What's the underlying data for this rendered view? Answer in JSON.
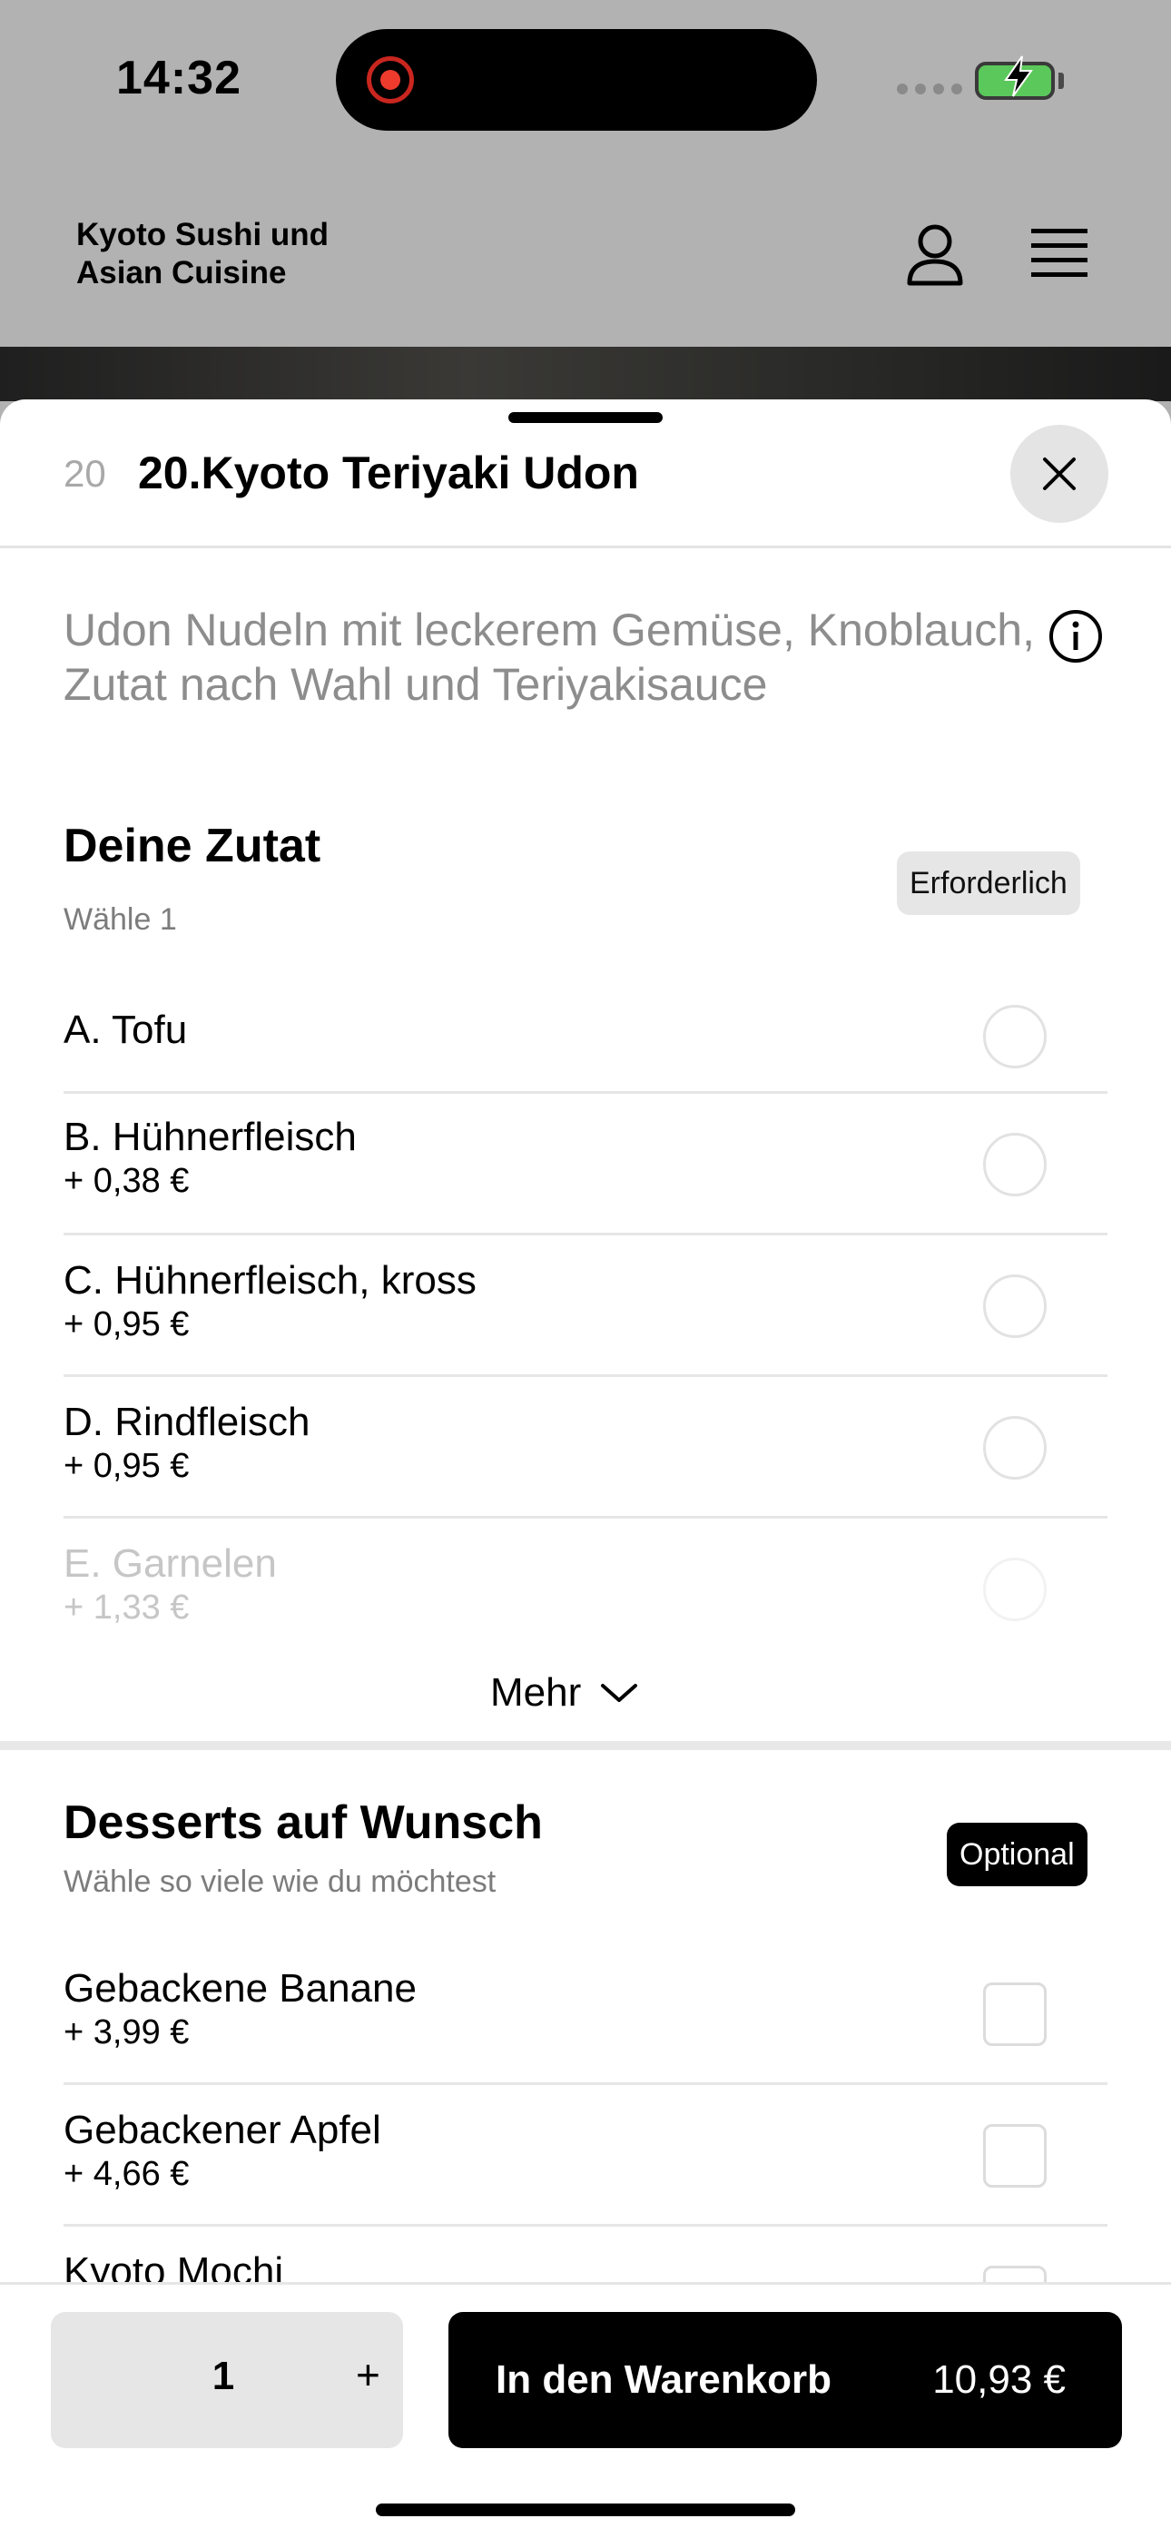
{
  "status_bar": {
    "time": "14:32",
    "battery_color": "#5ac85a",
    "recording_color": "#ef3b2d"
  },
  "header": {
    "restaurant_name": "Kyoto Sushi und Asian Cuisine",
    "profile_icon": "person-icon",
    "menu_icon": "hamburger-menu-icon"
  },
  "item": {
    "number": "20",
    "title": "20.Kyoto Teriyaki Udon",
    "description": "Udon Nudeln mit leckerem Gemüse, Knoblauch, Zutat nach Wahl und Teriyakisauce",
    "close_icon": "close-icon",
    "info_icon": "info-icon"
  },
  "group_ingredient": {
    "title": "Deine Zutat",
    "subtitle": "Wähle 1",
    "badge": "Erforderlich",
    "options": [
      {
        "name": "A. Tofu",
        "price": ""
      },
      {
        "name": "B. Hühnerfleisch",
        "price": "+ 0,38 €"
      },
      {
        "name": "C. Hühnerfleisch, kross",
        "price": "+ 0,95 €"
      },
      {
        "name": "D. Rindfleisch",
        "price": "+ 0,95 €"
      },
      {
        "name": "E. Garnelen",
        "price": "+ 1,33 €"
      }
    ],
    "more_label": "Mehr"
  },
  "group_desserts": {
    "title": "Desserts auf Wunsch",
    "subtitle": "Wähle so viele wie du möchtest",
    "badge": "Optional",
    "options": [
      {
        "name": "Gebackene Banane",
        "price": "+ 3,99 €"
      },
      {
        "name": "Gebackener Apfel",
        "price": "+ 4,66 €"
      },
      {
        "name": "Kyoto Mochi",
        "price": ""
      }
    ]
  },
  "bottom_bar": {
    "quantity": "1",
    "plus_label": "+",
    "cart_label": "In den Warenkorb",
    "cart_price": "10,93 €"
  }
}
